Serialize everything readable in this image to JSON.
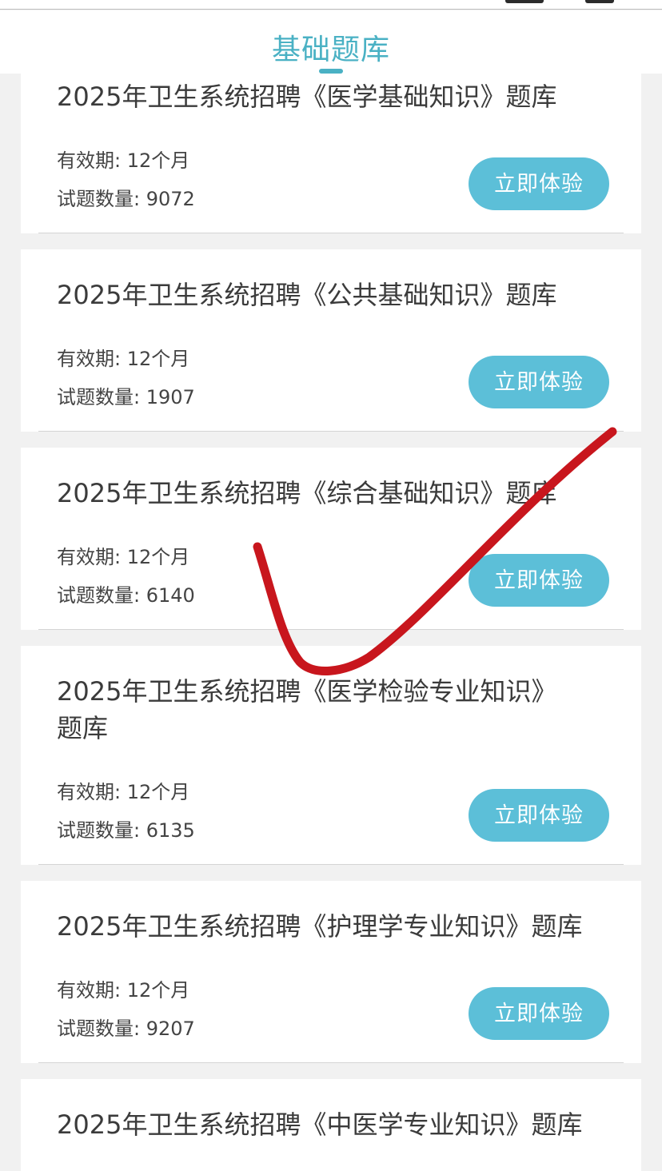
{
  "header": {
    "title": "基础题库"
  },
  "labels": {
    "validity": "有效期: ",
    "count": "试题数量: "
  },
  "courses": [
    {
      "title": "2025年卫生系统招聘《医学基础知识》题库",
      "validity": "12个月",
      "count": "9072",
      "button": "立即体验"
    },
    {
      "title": "2025年卫生系统招聘《公共基础知识》题库",
      "validity": "12个月",
      "count": "1907",
      "button": "立即体验"
    },
    {
      "title": "2025年卫生系统招聘《综合基础知识》题库",
      "validity": "12个月",
      "count": "6140",
      "button": "立即体验"
    },
    {
      "title_line1": "2025年卫生系统招聘《医学检验专业知识》",
      "title_line2": "题库",
      "validity": "12个月",
      "count": "6135",
      "button": "立即体验"
    },
    {
      "title": "2025年卫生系统招聘《护理学专业知识》题库",
      "validity": "12个月",
      "count": "9207",
      "button": "立即体验"
    },
    {
      "title": "2025年卫生系统招聘《中医学专业知识》题库"
    }
  ],
  "colors": {
    "accent": "#4ab1c4",
    "button": "#5cbfd8",
    "check_mark": "#c8161d"
  }
}
